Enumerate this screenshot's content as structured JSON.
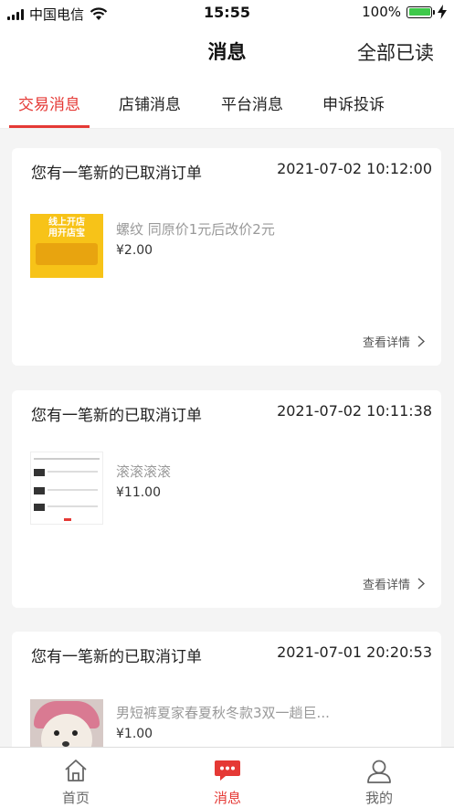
{
  "status_bar": {
    "carrier": "中国电信",
    "time": "15:55",
    "battery": "100%",
    "battery_level": 1.0
  },
  "nav": {
    "title": "消息",
    "read_all": "全部已读"
  },
  "tabs": [
    {
      "label": "交易消息",
      "active": true
    },
    {
      "label": "店铺消息",
      "active": false
    },
    {
      "label": "平台消息",
      "active": false
    },
    {
      "label": "申诉投诉",
      "active": false
    }
  ],
  "messages": [
    {
      "title": "您有一笔新的已取消订单",
      "time": "2021-07-02 10:12:00",
      "product": "螺纹  同原价1元后改价2元",
      "price": "¥2.00",
      "detail": "查看详情",
      "thumb_text": [
        "线上开店",
        "用开店宝"
      ]
    },
    {
      "title": "您有一笔新的已取消订单",
      "time": "2021-07-02 10:11:38",
      "product": "滚滚滚滚",
      "price": "¥11.00",
      "detail": "查看详情"
    },
    {
      "title": "您有一笔新的已取消订单",
      "time": "2021-07-01 20:20:53",
      "product": "男短裤夏家春夏秋冬款3双一趟巨...",
      "price": "¥1.00"
    }
  ],
  "bottom_nav": [
    {
      "label": "首页",
      "icon": "home-icon",
      "active": false
    },
    {
      "label": "消息",
      "icon": "message-icon",
      "active": true
    },
    {
      "label": "我的",
      "icon": "user-icon",
      "active": false
    }
  ],
  "colors": {
    "accent": "#e53935",
    "battery_green": "#3ec94a",
    "background": "#f4f4f4"
  }
}
